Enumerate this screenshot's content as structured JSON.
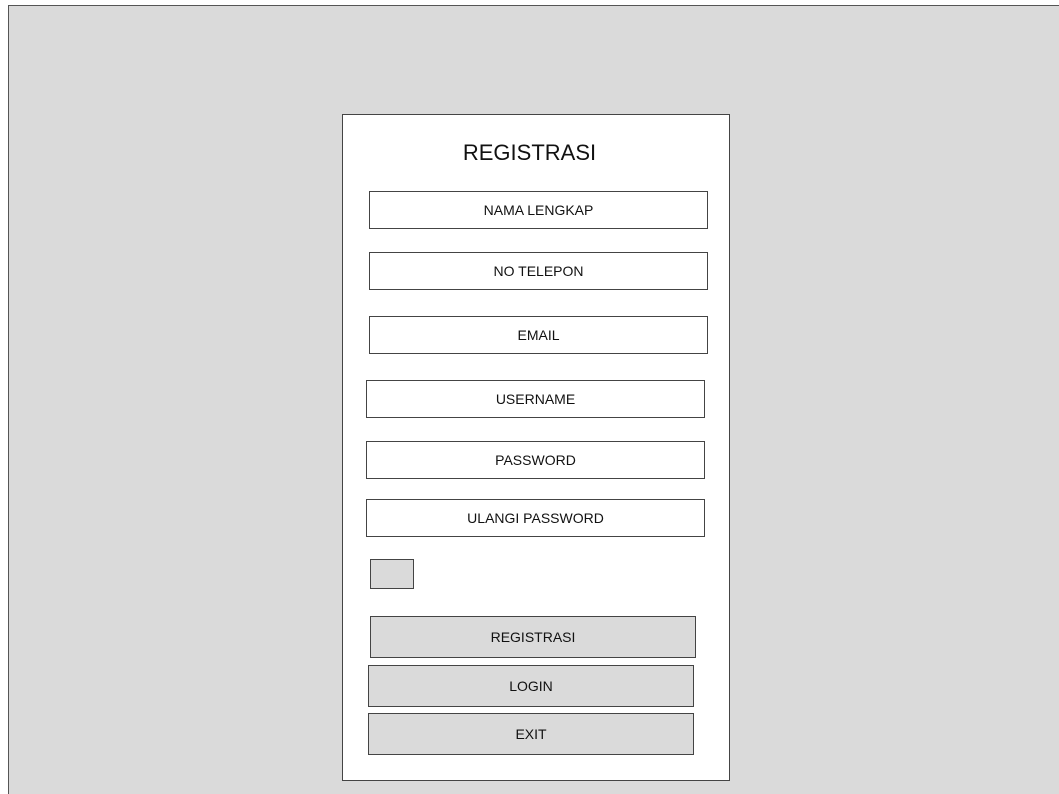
{
  "form": {
    "title": "REGISTRASI",
    "fields": [
      {
        "placeholder": "NAMA LENGKAP"
      },
      {
        "placeholder": "NO TELEPON"
      },
      {
        "placeholder": "EMAIL"
      },
      {
        "placeholder": "USERNAME"
      },
      {
        "placeholder": "PASSWORD"
      },
      {
        "placeholder": "ULANGI PASSWORD"
      }
    ],
    "buttons": {
      "register": "REGISTRASI",
      "login": "LOGIN",
      "exit": "EXIT"
    }
  },
  "colors": {
    "background": "#dadada",
    "panel": "#ffffff",
    "border": "#444444"
  }
}
